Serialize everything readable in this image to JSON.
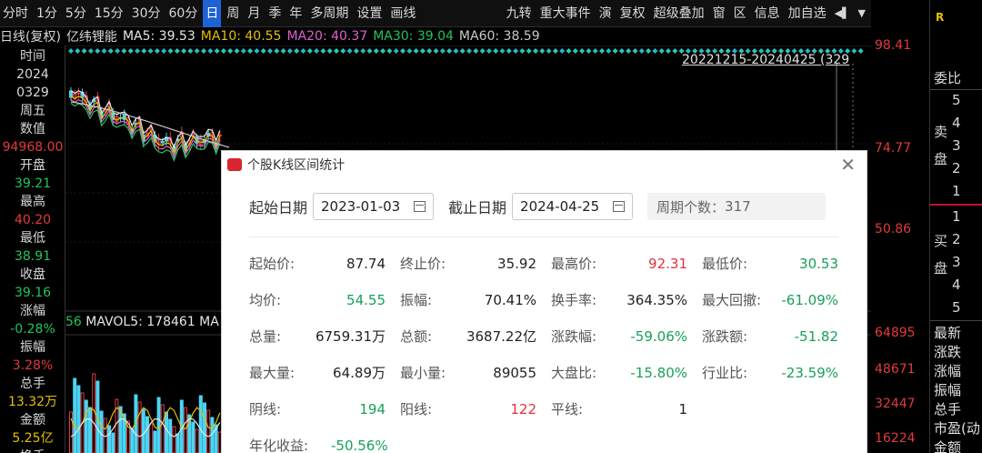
{
  "toolbar": {
    "items": [
      "分时",
      "1分",
      "5分",
      "15分",
      "30分",
      "60分",
      "日",
      "周",
      "月",
      "季",
      "年",
      "多周期",
      "设置",
      "画线"
    ],
    "active_index": 6,
    "right_items": [
      "九转",
      "重大事件",
      "演",
      "复权",
      "超级叠加",
      "窗",
      "区",
      "信息",
      "加自选"
    ],
    "more_icons": [
      "speaker-icon",
      "chevron-down-icon"
    ]
  },
  "ma_legend": {
    "prefix": "日线(复权)",
    "stock_name": "亿纬锂能",
    "ma5": "MA5: 39.53",
    "ma10": "MA10: 40.55",
    "ma20": "MA20: 40.37",
    "ma30": "MA30: 39.04",
    "ma60": "MA60: 38.59"
  },
  "left_col": [
    {
      "text": "时间",
      "color": "#d8d8d8"
    },
    {
      "text": "2024",
      "color": "#d8d8d8"
    },
    {
      "text": "0329",
      "color": "#d8d8d8"
    },
    {
      "text": "周五",
      "color": "#d8d8d8"
    },
    {
      "text": "数值",
      "color": "#d8d8d8"
    },
    {
      "text": "94968.00",
      "color": "#e23b3b"
    },
    {
      "text": "开盘",
      "color": "#d8d8d8"
    },
    {
      "text": "39.21",
      "color": "#22c45c"
    },
    {
      "text": "最高",
      "color": "#d8d8d8"
    },
    {
      "text": "40.20",
      "color": "#e23b3b"
    },
    {
      "text": "最低",
      "color": "#d8d8d8"
    },
    {
      "text": "38.91",
      "color": "#22c45c"
    },
    {
      "text": "收盘",
      "color": "#d8d8d8"
    },
    {
      "text": "39.16",
      "color": "#22c45c"
    },
    {
      "text": "涨幅",
      "color": "#d8d8d8"
    },
    {
      "text": "-0.28%",
      "color": "#22c45c"
    },
    {
      "text": "振幅",
      "color": "#d8d8d8"
    },
    {
      "text": "3.28%",
      "color": "#e23b3b"
    },
    {
      "text": "总手",
      "color": "#d8d8d8"
    },
    {
      "text": "13.32万",
      "color": "#e6c000"
    },
    {
      "text": "金额",
      "color": "#d8d8d8"
    },
    {
      "text": "5.25亿",
      "color": "#e6c000"
    },
    {
      "text": "换手",
      "color": "#d8d8d8"
    }
  ],
  "range_label": "20221215-20240425 (329",
  "vol_legend": {
    "prefix": "56",
    "mavol5": "MAVOL5: 178461",
    "suffix": "MA"
  },
  "yaxis": {
    "price": [
      "98.41",
      "74.77",
      "50.86"
    ],
    "volume": [
      "64895",
      "48671",
      "32447",
      "16224"
    ]
  },
  "right_panel": {
    "logo": "R",
    "webi": "委比",
    "sell_label": "卖盘",
    "buy_label": "买盘",
    "sell_levels": [
      "5",
      "4",
      "3",
      "2",
      "1"
    ],
    "buy_levels": [
      "1",
      "2",
      "3",
      "4",
      "5"
    ],
    "fields": [
      "最新",
      "涨跌",
      "涨幅",
      "振幅",
      "总手",
      "市盈(动",
      "金额"
    ]
  },
  "modal": {
    "title": "个股K线区间统计",
    "start_label": "起始日期",
    "start_date": "2023-01-03",
    "end_label": "截止日期",
    "end_date": "2024-04-25",
    "period_label": "周期个数：",
    "period_count": "317",
    "rows": [
      [
        {
          "label": "起始价:",
          "value": "87.74",
          "color": "dark"
        },
        {
          "label": "终止价:",
          "value": "35.92",
          "color": "dark"
        },
        {
          "label": "最高价:",
          "value": "92.31",
          "color": "red"
        },
        {
          "label": "最低价:",
          "value": "30.53",
          "color": "green"
        }
      ],
      [
        {
          "label": "均价:",
          "value": "54.55",
          "color": "green"
        },
        {
          "label": "振幅:",
          "value": "70.41%",
          "color": "dark"
        },
        {
          "label": "换手率:",
          "value": "364.35%",
          "color": "dark"
        },
        {
          "label": "最大回撤:",
          "value": "-61.09%",
          "color": "green"
        }
      ],
      [
        {
          "label": "总量:",
          "value": "6759.31万",
          "color": "dark"
        },
        {
          "label": "总额:",
          "value": "3687.22亿",
          "color": "dark"
        },
        {
          "label": "涨跌幅:",
          "value": "-59.06%",
          "color": "green"
        },
        {
          "label": "涨跌额:",
          "value": "-51.82",
          "color": "green"
        }
      ],
      [
        {
          "label": "最大量:",
          "value": "64.89万",
          "color": "dark"
        },
        {
          "label": "最小量:",
          "value": "89055",
          "color": "dark"
        },
        {
          "label": "大盘比:",
          "value": "-15.80%",
          "color": "green"
        },
        {
          "label": "行业比:",
          "value": "-23.59%",
          "color": "green"
        }
      ],
      [
        {
          "label": "阴线:",
          "value": "194",
          "color": "green"
        },
        {
          "label": "阳线:",
          "value": "122",
          "color": "red"
        },
        {
          "label": "平线:",
          "value": "1",
          "color": "dark"
        }
      ],
      [
        {
          "label": "年化收益:",
          "value": "-50.56%",
          "color": "green"
        }
      ]
    ]
  },
  "colors": {
    "up": "#e23b3b",
    "down": "#22c45c",
    "accent": "#1e63d6",
    "ma5": "#e6e6e6",
    "ma10": "#e6c000",
    "ma20": "#e060d0",
    "ma30": "#22c45c",
    "ma60": "#c8c8c8"
  }
}
